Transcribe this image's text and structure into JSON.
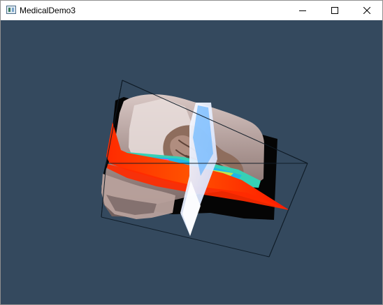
{
  "window": {
    "title": "MedicalDemo3",
    "icon": "app-window-icon",
    "controls": {
      "minimize": "minimize-icon",
      "maximize": "maximize-icon",
      "close": "close-icon"
    }
  },
  "viewport": {
    "background_color": "#34495e",
    "content": "3d-medical-volume-render"
  }
}
